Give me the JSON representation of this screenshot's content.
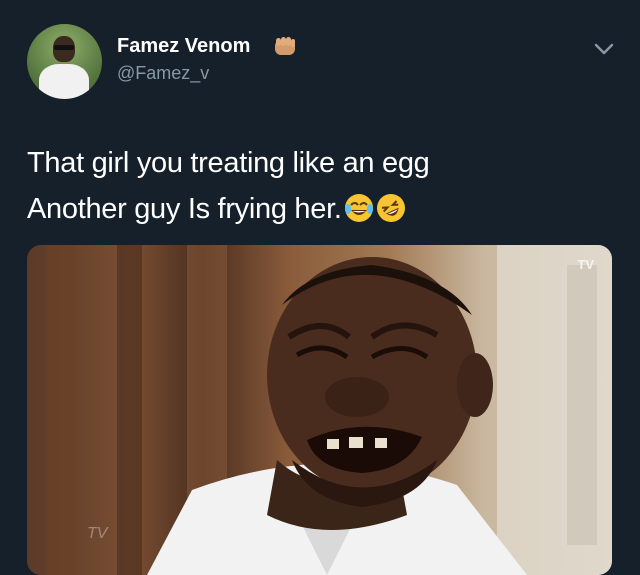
{
  "user": {
    "display_name": "Famez Venom",
    "handle": "@Famez_v",
    "badge_icon": "raised-fist-emoji"
  },
  "tweet": {
    "lines": [
      "That girl you treating like an egg",
      "Another guy Is frying her."
    ],
    "emojis": [
      "face-with-tears-of-joy-emoji",
      "rolling-on-floor-laughing-emoji"
    ]
  },
  "menu": {
    "icon": "chevron-down-icon"
  },
  "media": {
    "watermark": "TV"
  },
  "colors": {
    "background": "#15202b",
    "text": "#ffffff",
    "secondary_text": "#8899a6"
  }
}
